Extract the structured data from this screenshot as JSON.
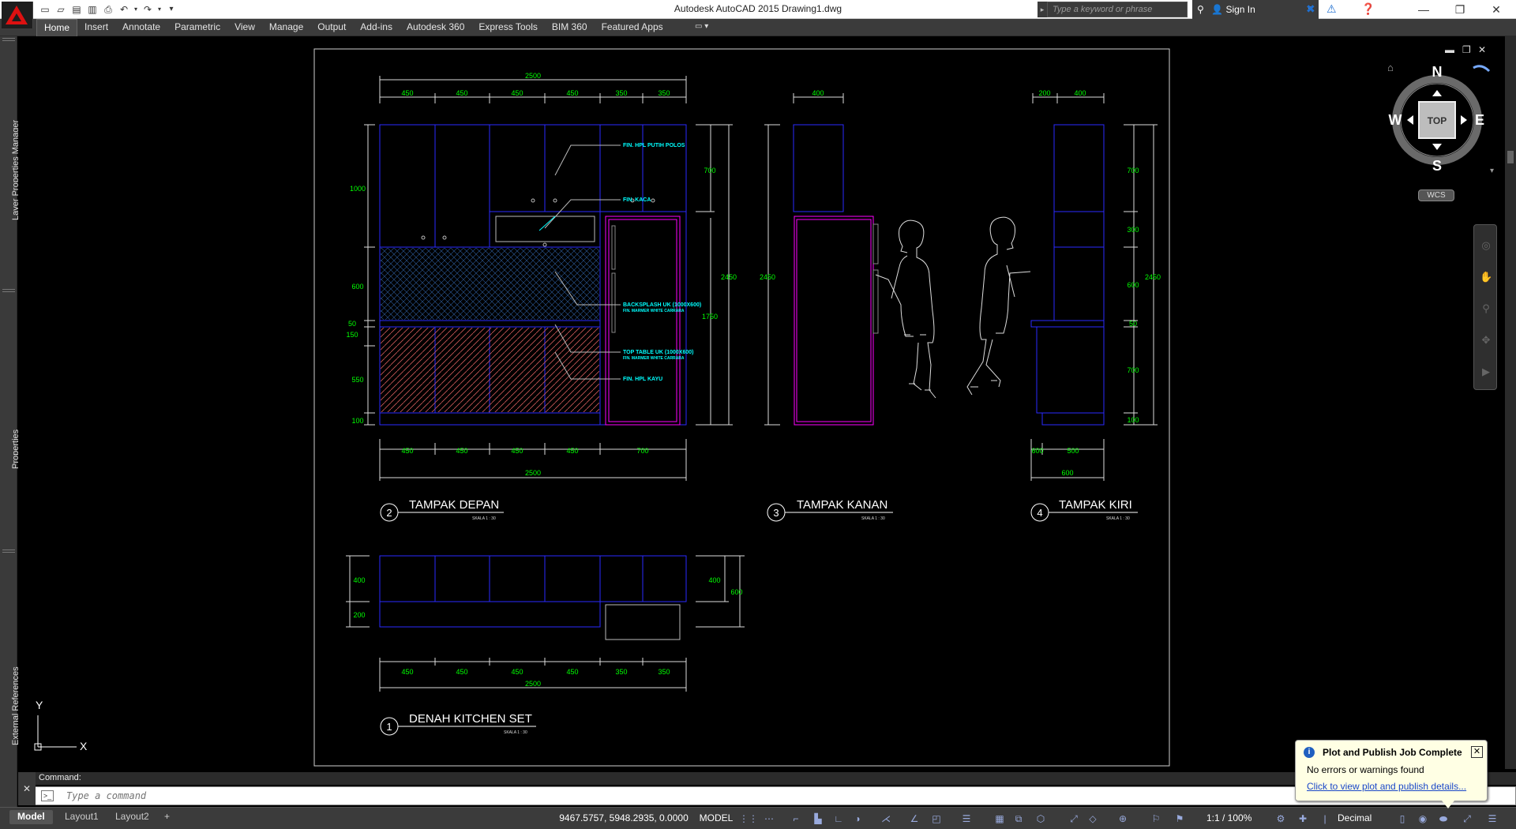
{
  "app": {
    "title": "Autodesk AutoCAD 2015    Drawing1.dwg",
    "search_placeholder": "Type a keyword or phrase",
    "sign_in": "Sign In"
  },
  "ribbon": {
    "tabs": [
      "Home",
      "Insert",
      "Annotate",
      "Parametric",
      "View",
      "Manage",
      "Output",
      "Add-ins",
      "Autodesk 360",
      "Express Tools",
      "BIM 360",
      "Featured Apps"
    ],
    "active_tab": "Home"
  },
  "palettes": {
    "left": [
      "Layer Properties Manager",
      "Properties",
      "External References"
    ]
  },
  "viewcube": {
    "face": "TOP",
    "north": "N",
    "south": "S",
    "east": "E",
    "west": "W",
    "ucs": "WCS"
  },
  "ucs_icon": {
    "x_label": "X",
    "y_label": "Y"
  },
  "drawing": {
    "views": [
      {
        "number": "2",
        "title": "TAMPAK DEPAN",
        "scale": "SKALA 1 : 30"
      },
      {
        "number": "3",
        "title": "TAMPAK KANAN",
        "scale": "SKALA 1 : 30"
      },
      {
        "number": "4",
        "title": "TAMPAK KIRI",
        "scale": "SKALA 1 : 30"
      },
      {
        "number": "1",
        "title": "DENAH KITCHEN SET",
        "scale": "SKALA 1 : 30"
      }
    ],
    "front_dims_top": [
      "450",
      "450",
      "450",
      "450",
      "350",
      "350"
    ],
    "front_total": "2500",
    "front_dims_bottom": [
      "450",
      "450",
      "450",
      "450",
      "700"
    ],
    "front_left_heights": [
      "1000",
      "600",
      "50",
      "150",
      "550",
      "100"
    ],
    "front_right_heights": [
      "700",
      "2450",
      "1750"
    ],
    "annotations": [
      "FIN. HPL PUTIH POLOS",
      "FIN. KACA",
      "BACKSPLASH UK (1000X600)",
      "FIN. MARMER WHITE CARRARA",
      "TOP TABLE UK (1000X600)",
      "FIN. MARMER WHITE CARRARA",
      "FIN. HPL KAYU"
    ],
    "right_dims": {
      "top": "400",
      "height": "2450"
    },
    "left_view_dims": {
      "top": [
        "200",
        "400"
      ],
      "heights": [
        "700",
        "300",
        "600",
        "50",
        "700",
        "100"
      ],
      "total": "2450",
      "bottom": [
        "600",
        "500"
      ],
      "bottom_total": "600"
    },
    "plan_dims": {
      "left": [
        "400",
        "200"
      ],
      "right": [
        "400",
        "600"
      ],
      "bottom": [
        "450",
        "450",
        "450",
        "450",
        "350",
        "350"
      ],
      "total": "2500"
    }
  },
  "command": {
    "history": "Command:",
    "placeholder": "Type a command"
  },
  "status": {
    "layout_tabs": [
      "Model",
      "Layout1",
      "Layout2"
    ],
    "active_layout": "Model",
    "add_tab": "+",
    "coords": "9467.5757, 5948.2935, 0.0000",
    "space": "MODEL",
    "scale": "1:1 / 100%",
    "units": "Decimal"
  },
  "notification": {
    "title": "Plot and Publish Job Complete",
    "message": "No errors or warnings found",
    "link": "Click to view plot and publish details..."
  },
  "colors": {
    "accent": "#1f6fd0",
    "dim": "#00ff00",
    "cabinet": "#2020ff",
    "fridge": "#ff00ff",
    "annotation": "#00ffff",
    "hatch": "#ff6060"
  }
}
